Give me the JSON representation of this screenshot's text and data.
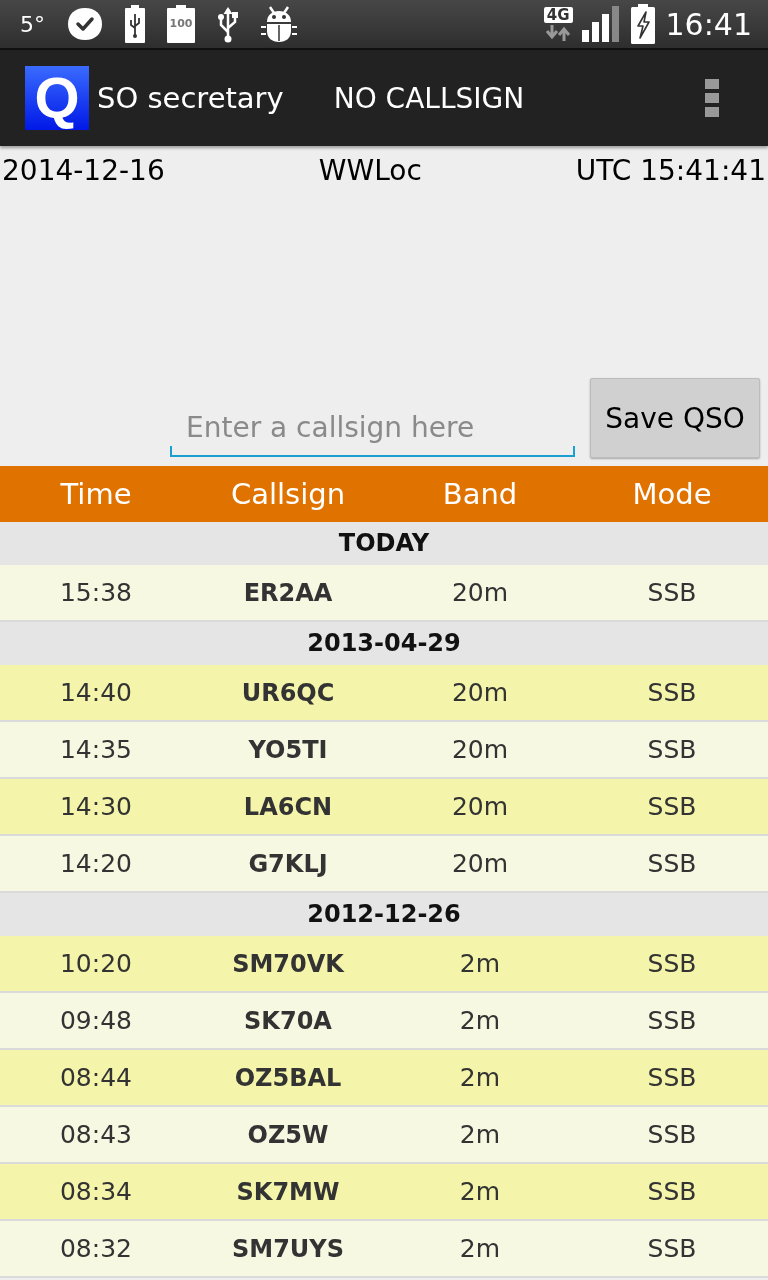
{
  "status_bar": {
    "temperature": "5°",
    "battery_percent": "100",
    "network_type": "4G",
    "clock": "16:41"
  },
  "action_bar": {
    "logo_letter": "Q",
    "title": "SO secretary",
    "callsign": "NO CALLSIGN"
  },
  "info": {
    "date": "2014-12-16",
    "locator": "WWLoc",
    "utc_time": "UTC 15:41:41"
  },
  "entry": {
    "placeholder": "Enter a callsign here",
    "save_button": "Save QSO"
  },
  "table": {
    "columns": [
      "Time",
      "Callsign",
      "Band",
      "Mode"
    ],
    "groups": [
      {
        "label": "TODAY",
        "rows": [
          {
            "time": "15:38",
            "callsign": "ER2AA",
            "band": "20m",
            "mode": "SSB"
          }
        ]
      },
      {
        "label": "2013-04-29",
        "rows": [
          {
            "time": "14:40",
            "callsign": "UR6QC",
            "band": "20m",
            "mode": "SSB"
          },
          {
            "time": "14:35",
            "callsign": "YO5TI",
            "band": "20m",
            "mode": "SSB"
          },
          {
            "time": "14:30",
            "callsign": "LA6CN",
            "band": "20m",
            "mode": "SSB"
          },
          {
            "time": "14:20",
            "callsign": "G7KLJ",
            "band": "20m",
            "mode": "SSB"
          }
        ]
      },
      {
        "label": "2012-12-26",
        "rows": [
          {
            "time": "10:20",
            "callsign": "SM70VK",
            "band": "2m",
            "mode": "SSB"
          },
          {
            "time": "09:48",
            "callsign": "SK70A",
            "band": "2m",
            "mode": "SSB"
          },
          {
            "time": "08:44",
            "callsign": "OZ5BAL",
            "band": "2m",
            "mode": "SSB"
          },
          {
            "time": "08:43",
            "callsign": "OZ5W",
            "band": "2m",
            "mode": "SSB"
          },
          {
            "time": "08:34",
            "callsign": "SK7MW",
            "band": "2m",
            "mode": "SSB"
          },
          {
            "time": "08:32",
            "callsign": "SM7UYS",
            "band": "2m",
            "mode": "SSB"
          }
        ]
      }
    ]
  }
}
